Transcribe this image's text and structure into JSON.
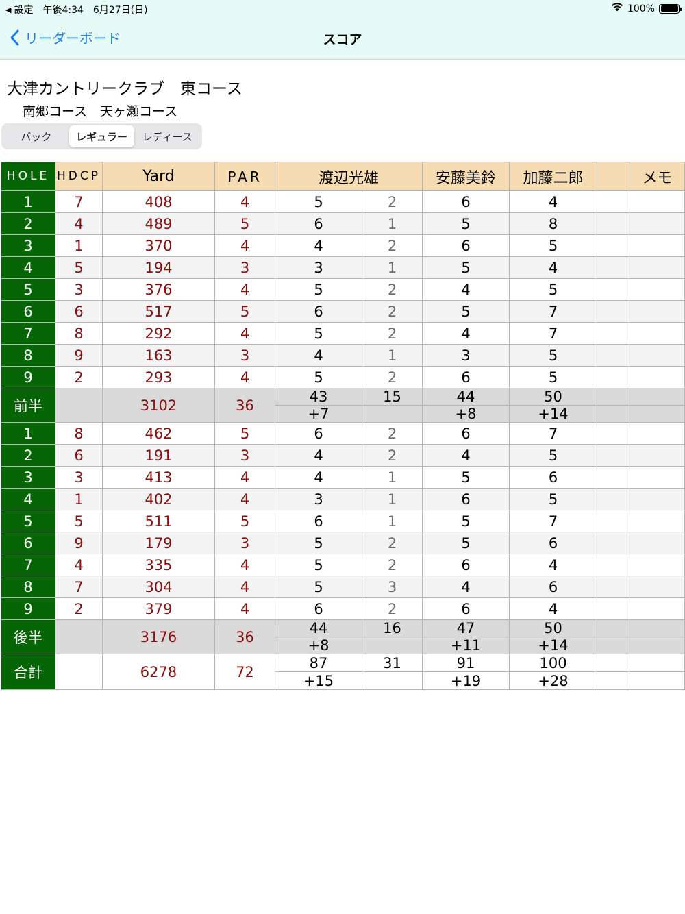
{
  "status_bar": {
    "back_app": "設定",
    "time": "午後4:34",
    "date": "6月27日(日)",
    "battery": "100%"
  },
  "nav": {
    "back_label": "リーダーボード",
    "title": "スコア"
  },
  "course": {
    "name": "大津カントリークラブ　東コース",
    "sub": "南郷コース　天ヶ瀬コース"
  },
  "tees": {
    "back": "バック",
    "regular": "レギュラー",
    "ladies": "レディース",
    "selected": "レギュラー"
  },
  "colors": {
    "hole_green": "#066606",
    "header_tan": "#f6dcb2",
    "value_red": "#8b0e0e",
    "nav_blue": "#1a7cf5",
    "topbar_bg": "#e6fbf6"
  },
  "table": {
    "headers": {
      "hole": "HOLE",
      "hdcp": "HDCP",
      "yard": "Yard",
      "par": "PAR",
      "player1": "渡辺光雄",
      "player2": "安藤美鈴",
      "player3": "加藤二郎",
      "memo": "メモ"
    },
    "front": [
      {
        "hole": "1",
        "hdcp": "7",
        "yard": "408",
        "par": "4",
        "p1": "5",
        "p1_putt": "2",
        "p2": "6",
        "p3": "4"
      },
      {
        "hole": "2",
        "hdcp": "4",
        "yard": "489",
        "par": "5",
        "p1": "6",
        "p1_putt": "1",
        "p2": "5",
        "p3": "8"
      },
      {
        "hole": "3",
        "hdcp": "1",
        "yard": "370",
        "par": "4",
        "p1": "4",
        "p1_putt": "2",
        "p2": "6",
        "p3": "5"
      },
      {
        "hole": "4",
        "hdcp": "5",
        "yard": "194",
        "par": "3",
        "p1": "3",
        "p1_putt": "1",
        "p2": "5",
        "p3": "4"
      },
      {
        "hole": "5",
        "hdcp": "3",
        "yard": "376",
        "par": "4",
        "p1": "5",
        "p1_putt": "2",
        "p2": "4",
        "p3": "5"
      },
      {
        "hole": "6",
        "hdcp": "6",
        "yard": "517",
        "par": "5",
        "p1": "6",
        "p1_putt": "2",
        "p2": "5",
        "p3": "7"
      },
      {
        "hole": "7",
        "hdcp": "8",
        "yard": "292",
        "par": "4",
        "p1": "5",
        "p1_putt": "2",
        "p2": "4",
        "p3": "7"
      },
      {
        "hole": "8",
        "hdcp": "9",
        "yard": "163",
        "par": "3",
        "p1": "4",
        "p1_putt": "1",
        "p2": "3",
        "p3": "5"
      },
      {
        "hole": "9",
        "hdcp": "2",
        "yard": "293",
        "par": "4",
        "p1": "5",
        "p1_putt": "2",
        "p2": "6",
        "p3": "5"
      }
    ],
    "front_total": {
      "label": "前半",
      "yard": "3102",
      "par": "36",
      "p1": "43",
      "p1_diff": "+7",
      "p1_putt": "15",
      "p2": "44",
      "p2_diff": "+8",
      "p3": "50",
      "p3_diff": "+14"
    },
    "back": [
      {
        "hole": "1",
        "hdcp": "8",
        "yard": "462",
        "par": "5",
        "p1": "6",
        "p1_putt": "2",
        "p2": "6",
        "p3": "7"
      },
      {
        "hole": "2",
        "hdcp": "6",
        "yard": "191",
        "par": "3",
        "p1": "4",
        "p1_putt": "2",
        "p2": "4",
        "p3": "5"
      },
      {
        "hole": "3",
        "hdcp": "3",
        "yard": "413",
        "par": "4",
        "p1": "4",
        "p1_putt": "1",
        "p2": "5",
        "p3": "6"
      },
      {
        "hole": "4",
        "hdcp": "1",
        "yard": "402",
        "par": "4",
        "p1": "3",
        "p1_putt": "1",
        "p2": "6",
        "p3": "5"
      },
      {
        "hole": "5",
        "hdcp": "5",
        "yard": "511",
        "par": "5",
        "p1": "6",
        "p1_putt": "1",
        "p2": "5",
        "p3": "7"
      },
      {
        "hole": "6",
        "hdcp": "9",
        "yard": "179",
        "par": "3",
        "p1": "5",
        "p1_putt": "2",
        "p2": "5",
        "p3": "6"
      },
      {
        "hole": "7",
        "hdcp": "4",
        "yard": "335",
        "par": "4",
        "p1": "5",
        "p1_putt": "2",
        "p2": "6",
        "p3": "4"
      },
      {
        "hole": "8",
        "hdcp": "7",
        "yard": "304",
        "par": "4",
        "p1": "5",
        "p1_putt": "3",
        "p2": "4",
        "p3": "6"
      },
      {
        "hole": "9",
        "hdcp": "2",
        "yard": "379",
        "par": "4",
        "p1": "6",
        "p1_putt": "2",
        "p2": "6",
        "p3": "4"
      }
    ],
    "back_total": {
      "label": "後半",
      "yard": "3176",
      "par": "36",
      "p1": "44",
      "p1_diff": "+8",
      "p1_putt": "16",
      "p2": "47",
      "p2_diff": "+11",
      "p3": "50",
      "p3_diff": "+14"
    },
    "grand_total": {
      "label": "合計",
      "yard": "6278",
      "par": "72",
      "p1": "87",
      "p1_diff": "+15",
      "p1_putt": "31",
      "p2": "91",
      "p2_diff": "+19",
      "p3": "100",
      "p3_diff": "+28"
    }
  }
}
